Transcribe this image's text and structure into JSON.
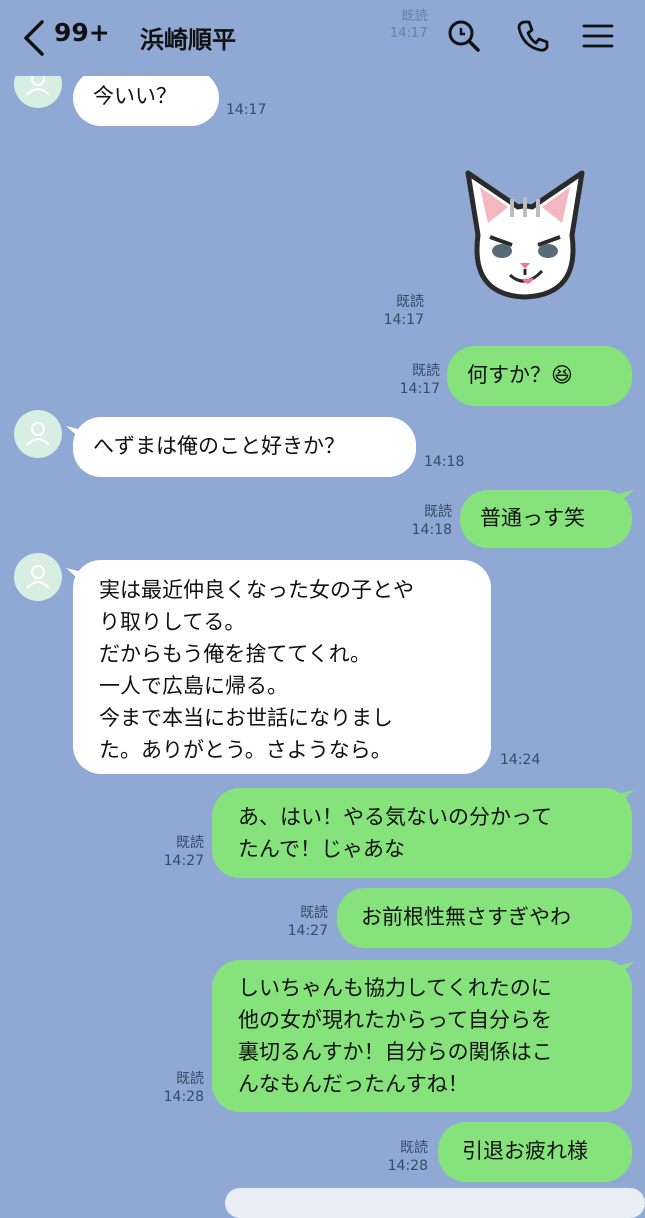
{
  "header": {
    "unread_count": "99+",
    "contact_name": "浜崎順平",
    "ghost_read": "既読",
    "ghost_time": "14:17",
    "icons": [
      "back-chevron-icon",
      "search-icon",
      "phone-icon",
      "menu-icon"
    ]
  },
  "messages": [
    {
      "from": "them",
      "text": "今いい？",
      "time": "14:17"
    },
    {
      "from": "me",
      "type": "sticker",
      "sticker": "white-cat-smirk-sticker",
      "read": "既読",
      "time": "14:17"
    },
    {
      "from": "me",
      "text": "何すか？😆",
      "read": "既読",
      "time": "14:17"
    },
    {
      "from": "them",
      "text": "へずまは俺のこと好きか？",
      "time": "14:18"
    },
    {
      "from": "me",
      "text": "普通っす笑",
      "read": "既読",
      "time": "14:18"
    },
    {
      "from": "them",
      "lines": [
        "実は最近仲良くなった女の子とや",
        "り取りしてる。",
        "だからもう俺を捨ててくれ。",
        "一人で広島に帰る。",
        "今まで本当にお世話になりまし",
        "た。ありがとう。さようなら。"
      ],
      "time": "14:24"
    },
    {
      "from": "me",
      "lines": [
        "あ、はい！やる気ないの分かって",
        "たんで！じゃあな"
      ],
      "read": "既読",
      "time": "14:27"
    },
    {
      "from": "me",
      "text": "お前根性無さすぎやわ",
      "read": "既読",
      "time": "14:27"
    },
    {
      "from": "me",
      "lines": [
        "しいちゃんも協力してくれたのに",
        "他の女が現れたからって自分らを",
        "裏切るんすか！自分らの関係はこ",
        "んなもんだったんすね！"
      ],
      "read": "既読",
      "time": "14:28"
    },
    {
      "from": "me",
      "text": "引退お疲れ様",
      "read": "既読",
      "time": "14:28"
    }
  ],
  "colors": {
    "background": "#8fa8d4",
    "incoming_bubble": "#ffffff",
    "outgoing_bubble": "#86e37b",
    "avatar": "#d9eee2"
  }
}
